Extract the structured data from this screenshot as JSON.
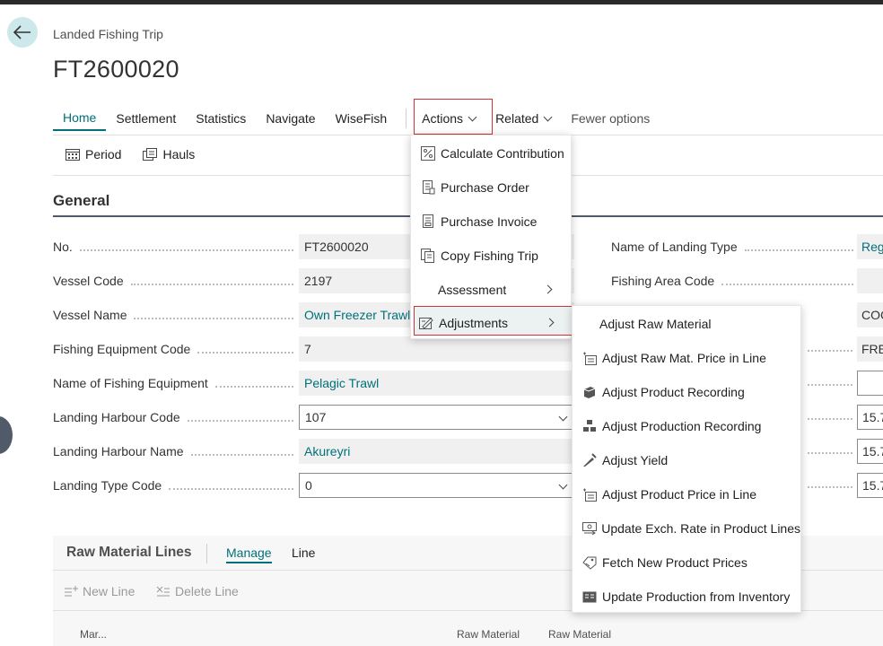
{
  "page": {
    "caption": "Landed Fishing Trip",
    "title": "FT2600020"
  },
  "actionbar": {
    "tabs": [
      "Home",
      "Settlement",
      "Statistics",
      "Navigate",
      "WiseFish"
    ],
    "actions": "Actions",
    "related": "Related",
    "fewer": "Fewer options"
  },
  "promoted": {
    "period": "Period",
    "hauls": "Hauls"
  },
  "general": {
    "title": "General",
    "fields": [
      {
        "label": "No.",
        "value": "FT2600020"
      },
      {
        "label": "Vessel Code",
        "value": "2197"
      },
      {
        "label": "Vessel Name",
        "value": "Own Freezer Trawle"
      },
      {
        "label": "Fishing Equipment Code",
        "value": "7"
      },
      {
        "label": "Name of Fishing Equipment",
        "value": "Pelagic Trawl"
      },
      {
        "label": "Landing Harbour Code",
        "value": "107"
      },
      {
        "label": "Landing Harbour Name",
        "value": "Akureyri"
      },
      {
        "label": "Landing Type Code",
        "value": "0"
      }
    ],
    "right_fields": [
      {
        "label": "Name of Landing Type",
        "value": "Reg"
      },
      {
        "label": "Fishing Area Code",
        "value": ""
      }
    ],
    "right_values": [
      "COC",
      "FRE",
      "",
      "15.7",
      "15.7",
      "15.7"
    ]
  },
  "actions_menu": [
    {
      "label": "Calculate Contribution",
      "icon": "percent-icon"
    },
    {
      "label": "Purchase Order",
      "icon": "order-icon"
    },
    {
      "label": "Purchase Invoice",
      "icon": "invoice-icon"
    },
    {
      "label": "Copy Fishing Trip",
      "icon": "copy-icon"
    },
    {
      "label": "Assessment",
      "icon": ""
    },
    {
      "label": "Adjustments",
      "icon": "adjust-icon"
    }
  ],
  "adjustments_menu": [
    "Adjust Raw Material",
    "Adjust Raw Mat. Price in Line",
    "Adjust Product Recording",
    "Adjust Production Recording",
    "Adjust Yield",
    "Adjust Product Price in Line",
    "Update Exch. Rate in Product Lines",
    "Fetch New Product Prices",
    "Update Production from Inventory"
  ],
  "lines": {
    "title": "Raw Material Lines",
    "tabs": [
      "Manage",
      "Line"
    ],
    "new_line": "New Line",
    "delete_line": "Delete Line",
    "columns": [
      "Mar...",
      "Raw Material",
      "Raw Material"
    ]
  },
  "colors": {
    "accent": "#00707a",
    "highlight_border": "#d13438"
  }
}
